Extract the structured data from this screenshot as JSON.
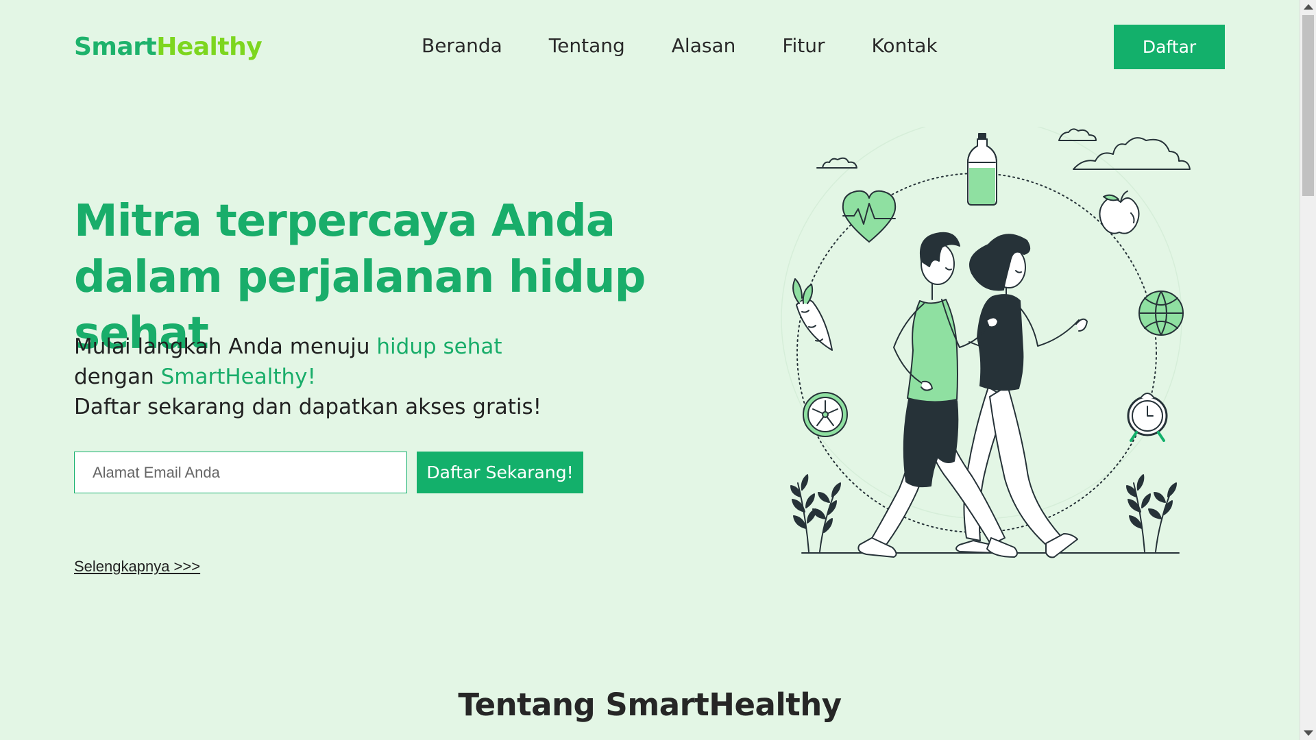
{
  "brand": {
    "part1": "Smart",
    "part2": "Healthy"
  },
  "nav": {
    "items": [
      {
        "label": "Beranda"
      },
      {
        "label": "Tentang"
      },
      {
        "label": "Alasan"
      },
      {
        "label": "Fitur"
      },
      {
        "label": "Kontak"
      }
    ],
    "cta_label": "Daftar"
  },
  "hero": {
    "title": "Mitra terpercaya Anda dalam perjalanan hidup sehat",
    "sub_line1_prefix": "Mulai langkah Anda menuju ",
    "sub_line1_highlight": "hidup sehat",
    "sub_line2_prefix": "dengan ",
    "sub_line2_highlight": "SmartHealthy!",
    "sub_line3": "Daftar sekarang dan dapatkan akses gratis!",
    "email_placeholder": "Alamat Email Anda",
    "signup_label": "Daftar Sekarang!",
    "more_link": "Selengkapnya >>>"
  },
  "about": {
    "title": "Tentang SmartHealthy"
  },
  "colors": {
    "background": "#e3f6e5",
    "primary": "#13b06b",
    "title_green": "#19ad6a",
    "logo_lime": "#7dd61f",
    "illustration_green": "#8fe0a1",
    "dark": "#263238"
  },
  "illustration": {
    "name": "couple-walking-healthy-lifestyle"
  }
}
